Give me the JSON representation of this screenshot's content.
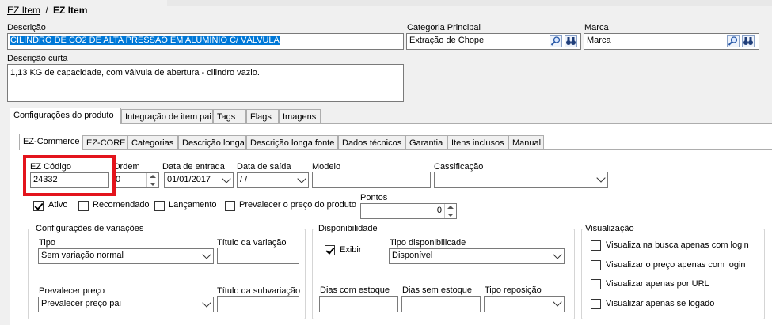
{
  "breadcrumb": {
    "root": "EZ Item",
    "separator": "/",
    "current": "EZ Item"
  },
  "top": {
    "descricao_label": "Descrição",
    "descricao_value": "CILINDRO DE CO2 DE ALTA PRESSÃO EM ALUMÍNIO C/ VÁLVULA",
    "categoria_label": "Categoria Principal",
    "categoria_value": "Extração de Chope",
    "marca_label": "Marca",
    "marca_value": "Marca",
    "descricao_curta_label": "Descrição curta",
    "descricao_curta_value": "1,13 KG de capacidade, com válvula de abertura - cilindro vazio."
  },
  "main_tabs": [
    "Configurações do produto",
    "Integração de item pai",
    "Tags",
    "Flags",
    "Imagens"
  ],
  "sub_tabs": [
    "EZ-Commerce",
    "EZ-CORE",
    "Categorias",
    "Descrição longa",
    "Descrição longa fonte",
    "Dados técnicos",
    "Garantia",
    "Itens inclusos",
    "Manual"
  ],
  "fields": {
    "ez_codigo_label": "EZ Código",
    "ez_codigo_value": "24332",
    "ordem_label": "Ordem",
    "ordem_value": "0",
    "data_entrada_label": "Data de entrada",
    "data_entrada_value": "01/01/2017",
    "data_saida_label": "Data de saída",
    "data_saida_value": " / /",
    "modelo_label": "Modelo",
    "modelo_value": "",
    "classificacao_label": "Cassificação",
    "classificacao_value": "",
    "pontos_label": "Pontos",
    "pontos_value": "0"
  },
  "checks": {
    "ativo": "Ativo",
    "recomendado": "Recomendado",
    "lancamento": "Lançamento",
    "prevalecer": "Prevalecer o preço do produto"
  },
  "variacoes": {
    "title": "Configurações de variações",
    "tipo_label": "Tipo",
    "tipo_value": "Sem variação normal",
    "titulo_variacao_label": "Título da variação",
    "prevalecer_label": "Prevalecer preço",
    "prevalecer_value": "Prevalecer preço pai",
    "titulo_subvariacao_label": "Título da subvariação"
  },
  "disponibilidade": {
    "title": "Disponibilidade",
    "exibir": "Exibir",
    "tipo_label": "Tipo disponibilicade",
    "tipo_value": "Disponível",
    "dias_com_label": "Dias com estoque",
    "dias_sem_label": "Dias sem estoque",
    "tipo_reposicao_label": "Tipo reposição"
  },
  "visualizacao": {
    "title": "Visualização",
    "items": [
      "Visualiza na busca apenas com login",
      "Visualizar o preço apenas com login",
      "Visualizar apenas por URL",
      "Visualizar apenas se logado"
    ]
  },
  "colors": {
    "highlight": "#0078d7",
    "callout": "#e3141c"
  }
}
